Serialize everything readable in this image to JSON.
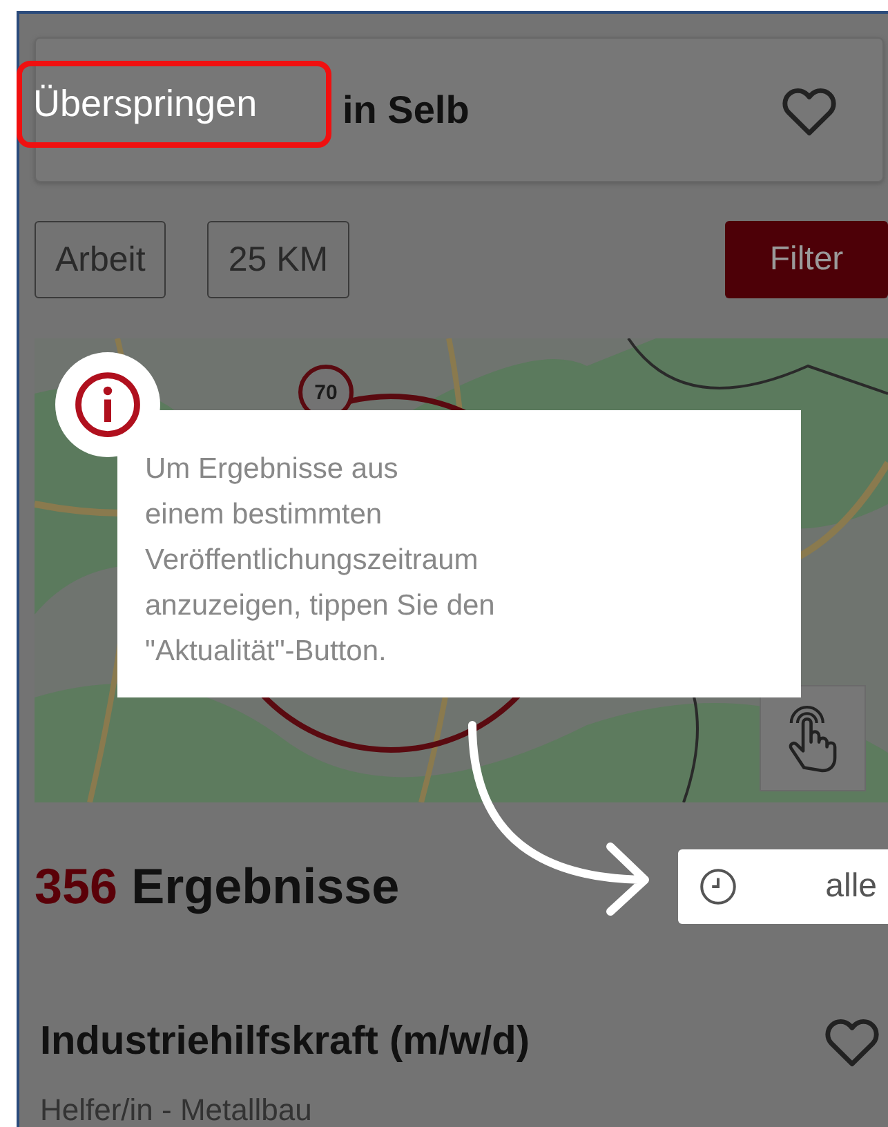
{
  "skip_button": {
    "label": "Überspringen"
  },
  "search": {
    "location_text": "in Selb",
    "favorite": false
  },
  "filters": [
    {
      "label": "Arbeit"
    },
    {
      "label": "25 KM"
    }
  ],
  "filter_button": {
    "label": "Filter"
  },
  "map": {
    "marker": "70"
  },
  "tooltip": {
    "text": "Um Ergebnisse aus\neinem bestimmten\nVeröffentlichungszeitraum\nanzuzeigen, tippen Sie den\n\"Aktualität\"-Button."
  },
  "results": {
    "count": "356",
    "label": "Ergebnisse",
    "time_button": "alle"
  },
  "jobs": [
    {
      "title": "Industriehilfskraft (m/w/d)",
      "subtitle": "Helfer/in - Metallbau",
      "favorite": false
    }
  ]
}
